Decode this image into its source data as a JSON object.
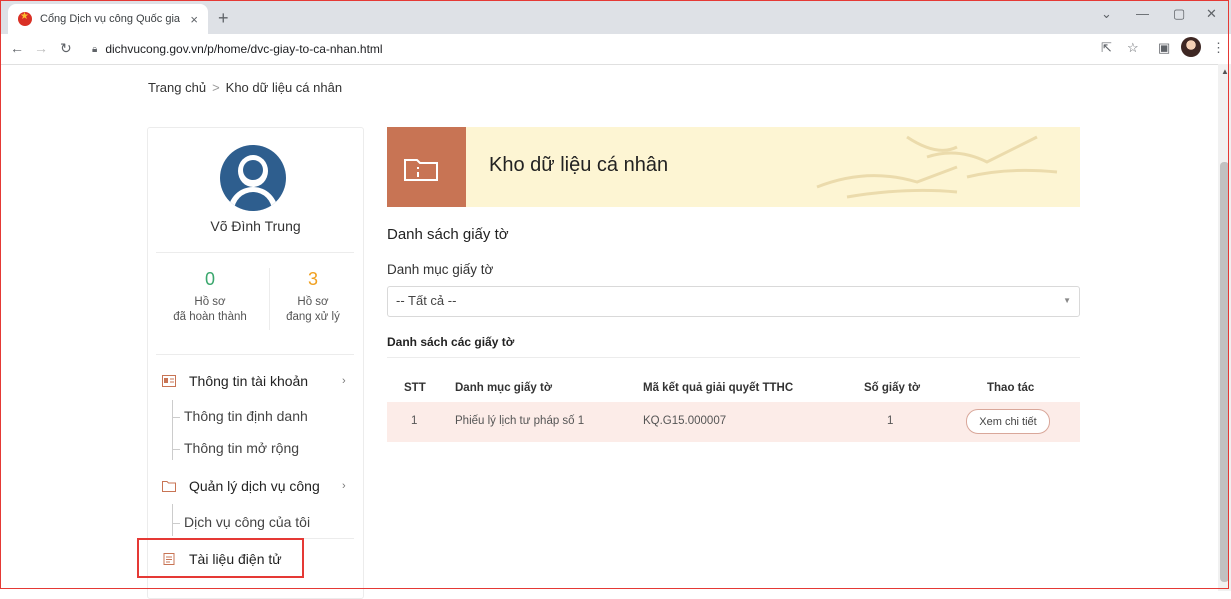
{
  "browser": {
    "tab_title": "Cổng Dịch vụ công Quốc gia",
    "tab_close": "×",
    "new_tab": "+",
    "url": "dichvucong.gov.vn/p/home/dvc-giay-to-ca-nhan.html",
    "icons": [
      "back-icon",
      "forward-icon",
      "reload-icon",
      "lock-icon",
      "share-icon",
      "star-icon",
      "sidebar-icon",
      "profile-icon",
      "menu-icon",
      "minimize-icon",
      "restore-icon",
      "close-icon"
    ]
  },
  "breadcrumb": {
    "home": "Trang chủ",
    "separator": ">",
    "current": "Kho dữ liệu cá nhân"
  },
  "sidebar": {
    "user_name": "Võ Đình Trung",
    "stats": [
      {
        "value": "0",
        "label_line1": "Hồ sơ",
        "label_line2": "đã hoàn thành",
        "color": "#3aa76d"
      },
      {
        "value": "3",
        "label_line1": "Hồ sơ",
        "label_line2": "đang xử lý",
        "color": "#f0a020"
      }
    ],
    "menu": {
      "account": {
        "label": "Thông tin tài khoản",
        "items": [
          "Thông tin định danh",
          "Thông tin mở rộng"
        ]
      },
      "services": {
        "label": "Quản lý dịch vụ công",
        "items": [
          "Dịch vụ công của tôi"
        ]
      },
      "documents": {
        "label": "Tài liệu điện tử"
      }
    }
  },
  "main": {
    "banner_title": "Kho dữ liệu cá nhân",
    "section_title": "Danh sách giấy tờ",
    "category_label": "Danh mục giấy tờ",
    "category_value": "-- Tất cả --",
    "list_title": "Danh sách các giấy tờ",
    "table": {
      "columns": [
        "STT",
        "Danh mục giấy tờ",
        "Mã kết quả giải quyết TTHC",
        "Số giấy tờ",
        "Thao tác"
      ],
      "rows": [
        {
          "stt": "1",
          "category": "Phiếu lý lịch tư pháp số 1",
          "code": "KQ.G15.000007",
          "count": "1",
          "action": "Xem chi tiết"
        }
      ]
    }
  },
  "colors": {
    "accent": "#c87454",
    "banner_bg": "#fdf5d3",
    "highlight": "#e53935",
    "row_bg": "#fcece8"
  }
}
